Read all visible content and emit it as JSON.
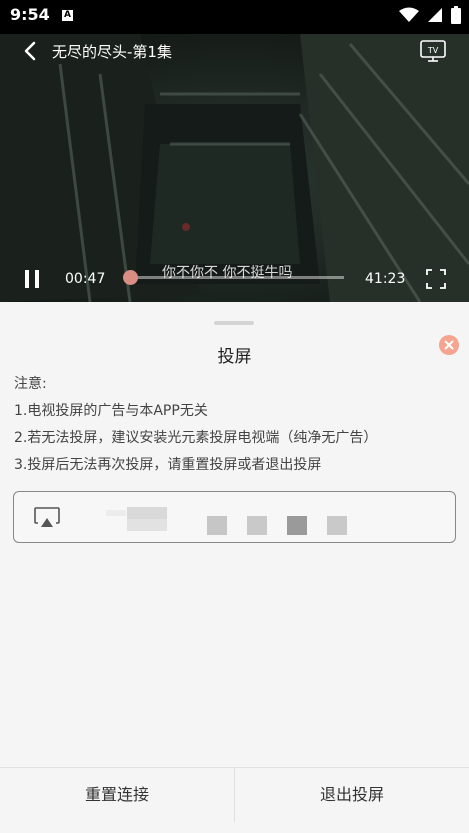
{
  "status_bar": {
    "time": "9:54",
    "notification_letter": "A"
  },
  "video": {
    "title": "无尽的尽头-第1集",
    "current_time": "00:47",
    "total_time": "41:23",
    "subtitle": "你不你不 你不挺牛吗",
    "progress_fraction": 0.019
  },
  "cast_sheet": {
    "title": "投屏",
    "notice_lines": [
      "注意:",
      "1.电视投屏的广告与本APP无关",
      "2.若无法投屏，建议安装光元素投屏电视端（纯净无广告）",
      "3.投屏后无法再次投屏，请重置投屏或者退出投屏"
    ]
  },
  "buttons": {
    "reset": "重置连接",
    "exit": "退出投屏"
  },
  "colors": {
    "accent_close": "#f4a48f",
    "progress_thumb": "#d98d83"
  }
}
